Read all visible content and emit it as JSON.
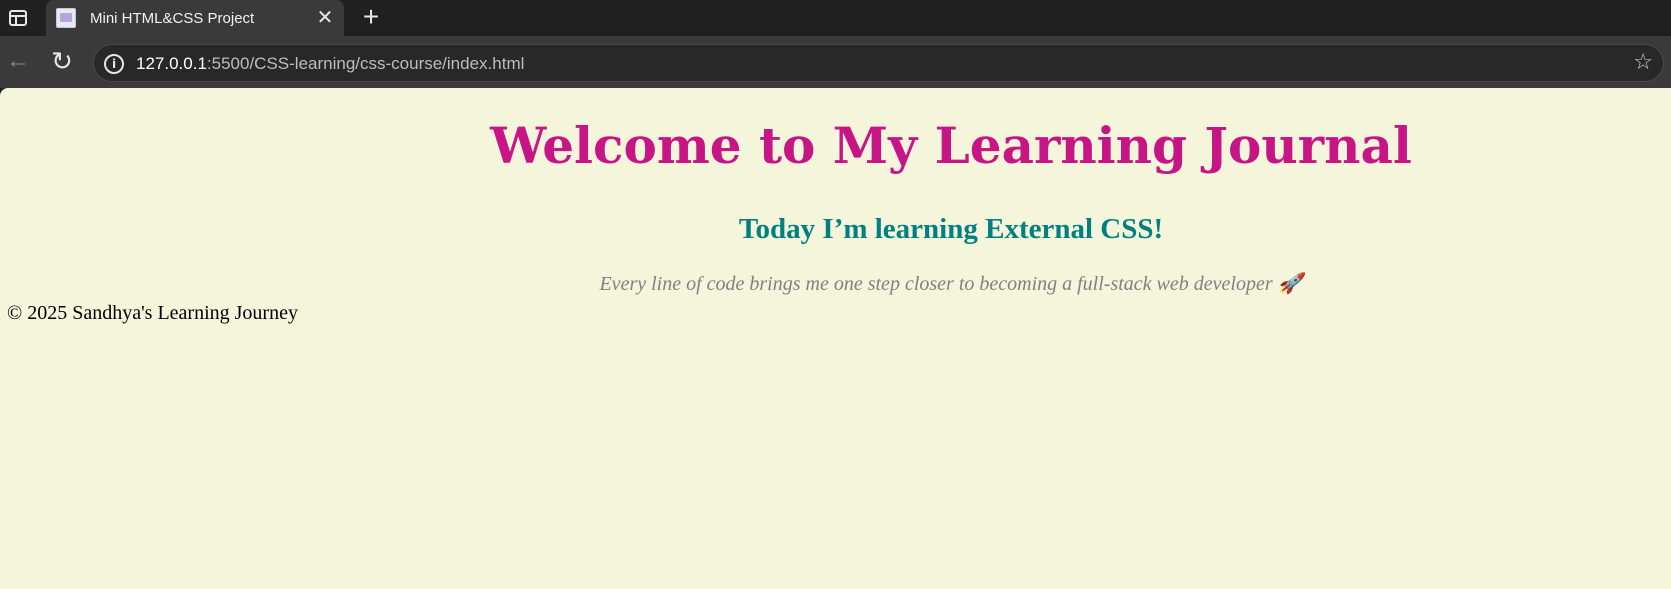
{
  "browser": {
    "tab": {
      "title": "Mini HTML&CSS Project",
      "close_glyph": "✕"
    },
    "new_tab_glyph": "+",
    "nav": {
      "back_glyph": "←",
      "reload_glyph": "↻"
    },
    "address": {
      "info_glyph": "i",
      "host": "127.0.0.1",
      "path": ":5500/CSS-learning/css-course/index.html",
      "star_glyph": "☆"
    }
  },
  "page": {
    "heading": "Welcome to My Learning Journal",
    "subheading": "Today I’m learning External CSS!",
    "paragraph": "Every line of code brings me one step closer to becoming a full-stack web developer 🚀",
    "footer": "© 2025 Sandhya's Learning Journey",
    "colors": {
      "background": "#f5f5dc",
      "heading": "#c71585",
      "subheading": "#008080",
      "paragraph": "#808080"
    }
  }
}
